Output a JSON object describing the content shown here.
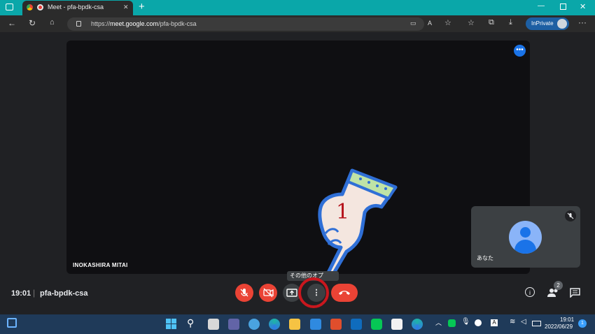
{
  "browser": {
    "tab_title": "Meet - pfa-bpdk-csa",
    "tab_close": "✕",
    "new_tab": "+",
    "url_scheme": "https://",
    "url_host": "meet.google.com",
    "url_path": "/pfa-bpdk-csa",
    "inprivate_label": "InPrivate"
  },
  "meet": {
    "participant_name": "INOKASHIRA MITAI",
    "self_name": "あなた",
    "time": "19:01",
    "meeting_code": "pfa-bpdk-csa",
    "tooltip": "その他のオプ",
    "people_count": "2",
    "more_tile_glyph": "•••",
    "more_options_glyph": "⋮"
  },
  "annotation": {
    "step_number": "1"
  },
  "taskbar": {
    "time": "19:01",
    "date": "2022/06/29",
    "notification_count": "1"
  },
  "colors": {
    "tab_strip": "#0aa7a9",
    "end_call": "#ea4335",
    "accent_blue": "#1a73e8",
    "annotation_red": "#c9171e"
  }
}
